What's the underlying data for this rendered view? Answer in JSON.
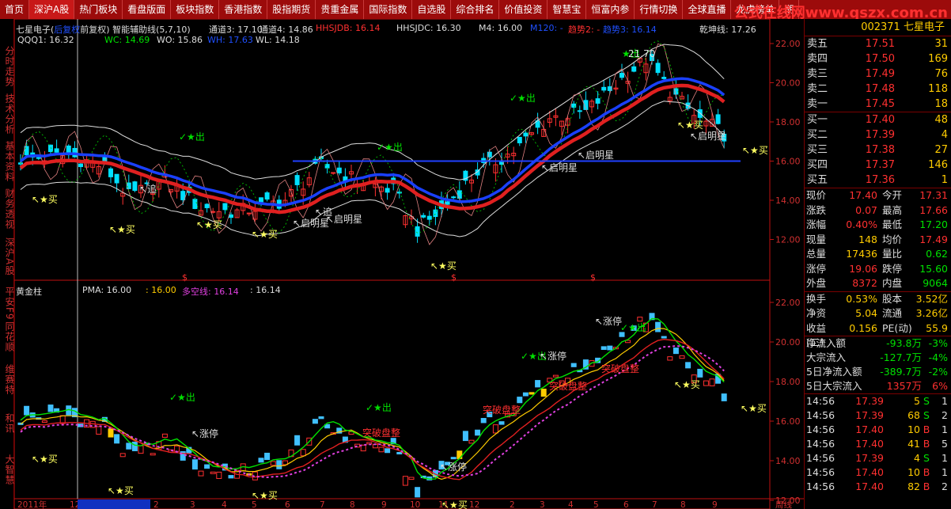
{
  "menu": [
    {
      "label": "首页",
      "active": false
    },
    {
      "label": "深沪A股",
      "active": true
    },
    {
      "label": "热门板块",
      "active": false
    },
    {
      "label": "看盘版面",
      "active": false
    },
    {
      "label": "板块指数",
      "active": false
    },
    {
      "label": "香港指数",
      "active": false
    },
    {
      "label": "股指期货",
      "active": false
    },
    {
      "label": "贵重金属",
      "active": false
    },
    {
      "label": "国际指数",
      "active": false
    },
    {
      "label": "自选股",
      "active": false
    },
    {
      "label": "综合排名",
      "active": false
    },
    {
      "label": "价值投资",
      "active": false
    },
    {
      "label": "智慧宝",
      "active": false
    },
    {
      "label": "恒富内参",
      "active": false
    },
    {
      "label": "行情切换",
      "active": false
    },
    {
      "label": "全球直播",
      "active": false
    },
    {
      "label": "龙虎榜单",
      "active": false
    },
    {
      "label": "期",
      "active": false
    }
  ],
  "watermark": "公式在线网www.qszx.com.cn",
  "left_tabs": [
    "分时走势",
    "技术分析",
    "基本资料",
    "财务透视",
    "深沪A股",
    "平安F9",
    "同花顺",
    "维赛特",
    "和讯",
    "大智慧"
  ],
  "upper_legend": {
    "title": "七星电子(",
    "title_hidden": "后复权",
    "title_rest": "前复权) 智能辅助线(5,7,10)",
    "tongdao3": "通道3: 17.10",
    "tongdao4": "通道4: 14.86",
    "hhsjdb": "HHSJDB: 16.14",
    "hhsjdc": "HHSJDC: 16.30",
    "m4": "M4: 16.00",
    "m120": "M120: -",
    "qushi2": "趋势2: -",
    "qushi3": "趋势3: 16.14",
    "qiankun": "乾坤线: 17.26",
    "qqq1": "QQQ1: 16.32",
    "wc": "WC: 14.69",
    "wo": "WO: 15.86",
    "wh": "WH: 17.63",
    "wl": "WL: 14.18"
  },
  "lower_legend": {
    "title": "黄金柱",
    "pma": "PMA: 16.00",
    "v2": ": 16.00",
    "duokong": "多空线: 16.14",
    "v4": ": 16.14"
  },
  "upper_axis": [
    "22.00",
    "20.00",
    "18.00",
    "16.00",
    "14.00",
    "12.00"
  ],
  "lower_axis": [
    "22.00",
    "20.00",
    "18.00",
    "16.00",
    "14.00",
    "12.00"
  ],
  "x_labels": [
    "2011年",
    "12",
    "2011/12/16/五",
    "2",
    "3",
    "4",
    "5",
    "6",
    "7",
    "8",
    "9",
    "10",
    "11",
    "12",
    "2",
    "3",
    "4",
    "5",
    "6",
    "7",
    "8",
    "9",
    "周线"
  ],
  "upper_annotations": {
    "chu1": "出",
    "chu2": "出",
    "chu3": "出",
    "chu4": "出",
    "zhui1": "追",
    "zhui2": "追",
    "qmx1": "启明星",
    "qmx2": "启明星",
    "qmx3": "启明星",
    "qmx4": "启明星",
    "qmx5": "启明星",
    "mai1": "买",
    "mai2": "买",
    "mai3": "买",
    "mai4": "买",
    "mai5": "买",
    "mai6": "买",
    "mai7": "买",
    "mai8": "买",
    "mai9": "买",
    "peak": "21.70"
  },
  "lower_annotations": {
    "chu1": "出",
    "chu2": "出",
    "chu3": "出",
    "chu4": "出",
    "zt1": "涨停",
    "zt2": "涨停",
    "zt3": "涨停",
    "zt4": "涨停",
    "tp1": "突破盘整",
    "tp2": "突破盘整",
    "tp3": "突破盘整",
    "tp4": "突破盘整",
    "mai1": "买",
    "mai2": "买",
    "mai3": "买",
    "mai4": "买",
    "mai5": "买",
    "mai6": "买"
  },
  "stock": {
    "code": "002371",
    "name": "七星电子"
  },
  "asks": [
    {
      "label": "卖五",
      "price": "17.51",
      "vol": "31"
    },
    {
      "label": "卖四",
      "price": "17.50",
      "vol": "169"
    },
    {
      "label": "卖三",
      "price": "17.49",
      "vol": "76"
    },
    {
      "label": "卖二",
      "price": "17.48",
      "vol": "118"
    },
    {
      "label": "卖一",
      "price": "17.45",
      "vol": "18"
    }
  ],
  "bids": [
    {
      "label": "买一",
      "price": "17.40",
      "vol": "48"
    },
    {
      "label": "买二",
      "price": "17.39",
      "vol": "4"
    },
    {
      "label": "买三",
      "price": "17.38",
      "vol": "27"
    },
    {
      "label": "买四",
      "price": "17.37",
      "vol": "146"
    },
    {
      "label": "买五",
      "price": "17.36",
      "vol": "1"
    }
  ],
  "quote": [
    {
      "k": "现价",
      "v": "17.40",
      "vc": "red",
      "k2": "今开",
      "v2": "17.31",
      "v2c": "red"
    },
    {
      "k": "涨跌",
      "v": "0.07",
      "vc": "red",
      "k2": "最高",
      "v2": "17.66",
      "v2c": "red"
    },
    {
      "k": "涨幅",
      "v": "0.40%",
      "vc": "red",
      "k2": "最低",
      "v2": "17.20",
      "v2c": "green"
    },
    {
      "k": "现量",
      "v": "148",
      "vc": "yellow",
      "k2": "均价",
      "v2": "17.49",
      "v2c": "red"
    },
    {
      "k": "总量",
      "v": "17436",
      "vc": "yellow",
      "k2": "量比",
      "v2": "0.62",
      "v2c": "green"
    },
    {
      "k": "涨停",
      "v": "19.06",
      "vc": "red",
      "k2": "跌停",
      "v2": "15.60",
      "v2c": "green"
    },
    {
      "k": "外盘",
      "v": "8372",
      "vc": "red",
      "k2": "内盘",
      "v2": "9064",
      "v2c": "green"
    }
  ],
  "finance": [
    {
      "k": "换手",
      "v": "0.53%",
      "vc": "yellow",
      "k2": "股本",
      "v2": "3.52亿",
      "v2c": "yellow"
    },
    {
      "k": "净资",
      "v": "5.04",
      "vc": "yellow",
      "k2": "流通",
      "v2": "3.26亿",
      "v2c": "yellow"
    },
    {
      "k": "收益(二)",
      "v": "0.156",
      "vc": "yellow",
      "k2": "PE(动)",
      "v2": "55.9",
      "v2c": "yellow"
    }
  ],
  "flows": [
    {
      "k": "净流入额",
      "v": "-93.8万",
      "vc": "green",
      "p": "-3%",
      "pc": "green"
    },
    {
      "k": "大宗流入",
      "v": "-127.7万",
      "vc": "green",
      "p": "-4%",
      "pc": "green"
    },
    {
      "k": "5日净流入额",
      "v": "-389.7万",
      "vc": "green",
      "p": "-2%",
      "pc": "green"
    },
    {
      "k": "5日大宗流入",
      "v": "1357万",
      "vc": "red",
      "p": "6%",
      "pc": "red"
    }
  ],
  "ticks": [
    {
      "t": "14:56",
      "p": "17.39",
      "v": "5",
      "bs": "S",
      "n": "1",
      "bsc": "green"
    },
    {
      "t": "14:56",
      "p": "17.39",
      "v": "68",
      "bs": "S",
      "n": "2",
      "bsc": "green"
    },
    {
      "t": "14:56",
      "p": "17.40",
      "v": "10",
      "bs": "B",
      "n": "1",
      "bsc": "red"
    },
    {
      "t": "14:56",
      "p": "17.40",
      "v": "41",
      "bs": "B",
      "n": "5",
      "bsc": "red"
    },
    {
      "t": "14:56",
      "p": "17.39",
      "v": "4",
      "bs": "S",
      "n": "1",
      "bsc": "green"
    },
    {
      "t": "14:56",
      "p": "17.40",
      "v": "10",
      "bs": "B",
      "n": "1",
      "bsc": "red"
    },
    {
      "t": "14:56",
      "p": "17.40",
      "v": "82",
      "bs": "B",
      "n": "2",
      "bsc": "red"
    }
  ],
  "colors": {
    "up": "#ff3030",
    "down": "#00e0ff",
    "axis": "#c01010",
    "bg": "#000000"
  }
}
